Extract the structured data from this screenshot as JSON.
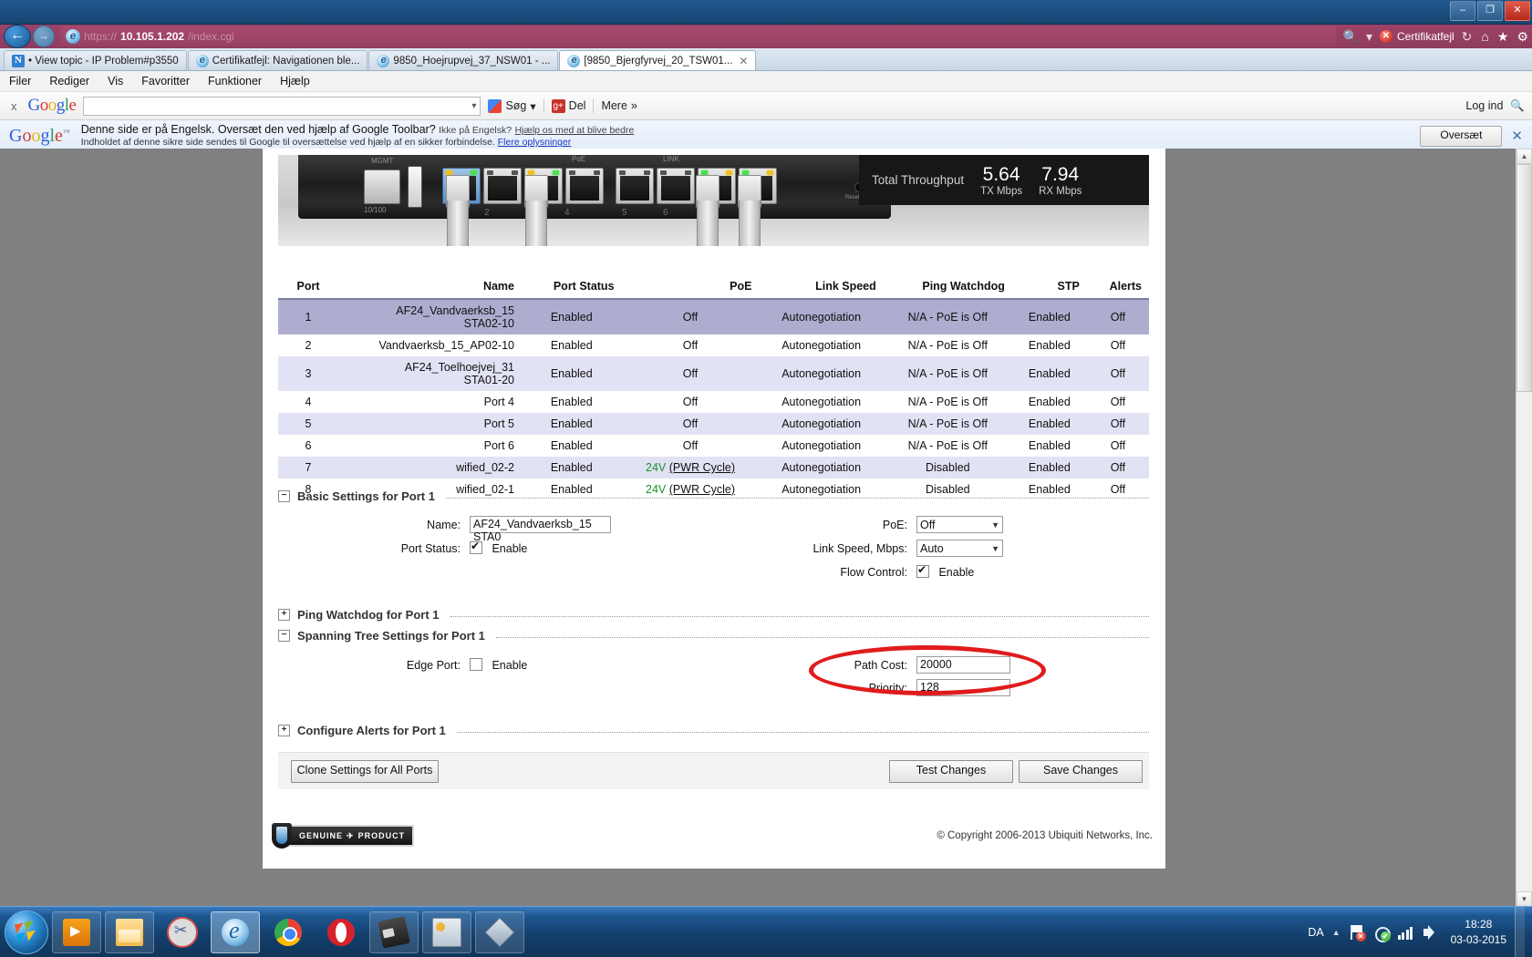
{
  "window": {
    "minimize_label": "–",
    "restore_label": "❐",
    "close_label": "✕"
  },
  "address_bar": {
    "protocol": "https://",
    "host": "10.105.1.202",
    "path": "/index.cgi",
    "back_icon": "←",
    "forward_icon": "→",
    "search_icon": "🔍",
    "dropdown_icon": "▾",
    "cert_error_label": "Certifikatfejl",
    "refresh_icon": "↻",
    "home_icon": "⌂",
    "favorites_icon": "★",
    "tools_icon": "⚙"
  },
  "tabs": [
    {
      "title": "• View topic - IP Problem#p3550",
      "icon": "N",
      "active": false,
      "closable": false
    },
    {
      "title": "Certifikatfejl: Navigationen ble...",
      "icon": "e",
      "active": false,
      "closable": false
    },
    {
      "title": "9850_Hoejrupvej_37_NSW01 - ...",
      "icon": "e",
      "active": false,
      "closable": false
    },
    {
      "title": "[9850_Bjergfyrvej_20_TSW01...",
      "icon": "e",
      "active": true,
      "closable": true,
      "close_label": "✕"
    }
  ],
  "menu_bar": [
    "Filer",
    "Rediger",
    "Vis",
    "Favoritter",
    "Funktioner",
    "Hjælp"
  ],
  "google_toolbar": {
    "close_label": "x",
    "logo": "Google",
    "search_input_value": "",
    "dropdown_icon": "▾",
    "search_label": "Søg",
    "search_caret": "▾",
    "share_label": "Del",
    "more_label": "Mere",
    "more_icon": "»",
    "login_label": "Log ind",
    "login_icon": "🔍"
  },
  "translate_bar": {
    "logo": "Google",
    "logo_tm": "™",
    "line1_main": "Denne side er på Engelsk. Oversæt den ved hjælp af Google Toolbar?",
    "line1_small": "Ikke på Engelsk?",
    "line1_link": "Hjælp os med at blive bedre",
    "line2_text": "Indholdet af denne sikre side sendes til Google til oversættelse ved hjælp af en sikker forbindelse.",
    "line2_link": "Flere oplysninger",
    "translate_button": "Oversæt",
    "close_label": "✕"
  },
  "device": {
    "mgmt_label": "MGMT",
    "poe_label": "PoE",
    "link_label": "LINK",
    "speed_label": "10/100",
    "reset_label": "Reset",
    "port_numbers": [
      "2",
      "4",
      "5",
      "6"
    ],
    "throughput_title": "Total Throughput",
    "tx_value": "5.64",
    "tx_unit": "TX Mbps",
    "rx_value": "7.94",
    "rx_unit": "RX Mbps"
  },
  "port_table": {
    "headers": [
      "Port",
      "Name",
      "Port Status",
      "PoE",
      "Link Speed",
      "Ping Watchdog",
      "STP",
      "Alerts"
    ],
    "rows": [
      {
        "port": "1",
        "name": "AF24_Vandvaerksb_15 STA02-10",
        "name_line1": "AF24_Vandvaerksb_15",
        "name_line2": "STA02-10",
        "status": "Enabled",
        "poe": "Off",
        "poe_voltage": "",
        "poe_link": "",
        "link_speed": "Autonegotiation",
        "watchdog": "N/A - PoE is Off",
        "stp": "Enabled",
        "alerts": "Off",
        "style": "selected"
      },
      {
        "port": "2",
        "name": "Vandvaerksb_15_AP02-10",
        "name_line1": "Vandvaerksb_15_AP02-10",
        "name_line2": "",
        "status": "Enabled",
        "poe": "Off",
        "poe_voltage": "",
        "poe_link": "",
        "link_speed": "Autonegotiation",
        "watchdog": "N/A - PoE is Off",
        "stp": "Enabled",
        "alerts": "Off",
        "style": "plain"
      },
      {
        "port": "3",
        "name": "AF24_Toelhoejvej_31 STA01-20",
        "name_line1": "AF24_Toelhoejvej_31",
        "name_line2": "STA01-20",
        "status": "Enabled",
        "poe": "Off",
        "poe_voltage": "",
        "poe_link": "",
        "link_speed": "Autonegotiation",
        "watchdog": "N/A - PoE is Off",
        "stp": "Enabled",
        "alerts": "Off",
        "style": "alt"
      },
      {
        "port": "4",
        "name": "Port 4",
        "name_line1": "Port 4",
        "name_line2": "",
        "status": "Enabled",
        "poe": "Off",
        "poe_voltage": "",
        "poe_link": "",
        "link_speed": "Autonegotiation",
        "watchdog": "N/A - PoE is Off",
        "stp": "Enabled",
        "alerts": "Off",
        "style": "plain"
      },
      {
        "port": "5",
        "name": "Port 5",
        "name_line1": "Port 5",
        "name_line2": "",
        "status": "Enabled",
        "poe": "Off",
        "poe_voltage": "",
        "poe_link": "",
        "link_speed": "Autonegotiation",
        "watchdog": "N/A - PoE is Off",
        "stp": "Enabled",
        "alerts": "Off",
        "style": "alt"
      },
      {
        "port": "6",
        "name": "Port 6",
        "name_line1": "Port 6",
        "name_line2": "",
        "status": "Enabled",
        "poe": "Off",
        "poe_voltage": "",
        "poe_link": "",
        "link_speed": "Autonegotiation",
        "watchdog": "N/A - PoE is Off",
        "stp": "Enabled",
        "alerts": "Off",
        "style": "plain"
      },
      {
        "port": "7",
        "name": "wified_02-2",
        "name_line1": "wified_02-2",
        "name_line2": "",
        "status": "Enabled",
        "poe": "",
        "poe_voltage": "24V",
        "poe_link": "(PWR Cycle)",
        "link_speed": "Autonegotiation",
        "watchdog": "Disabled",
        "stp": "Enabled",
        "alerts": "Off",
        "style": "alt"
      },
      {
        "port": "8",
        "name": "wified_02-1",
        "name_line1": "wified_02-1",
        "name_line2": "",
        "status": "Enabled",
        "poe": "",
        "poe_voltage": "24V",
        "poe_link": "(PWR Cycle)",
        "link_speed": "Autonegotiation",
        "watchdog": "Disabled",
        "stp": "Enabled",
        "alerts": "Off",
        "style": "plain"
      }
    ]
  },
  "basic_settings": {
    "section_title": "Basic Settings for Port 1",
    "toggle": "−",
    "name_label": "Name:",
    "name_value": "AF24_Vandvaerksb_15 STA0",
    "port_status_label": "Port Status:",
    "port_status_checked": true,
    "port_status_text": "Enable",
    "poe_label": "PoE:",
    "poe_value": "Off",
    "link_speed_label": "Link Speed, Mbps:",
    "link_speed_value": "Auto",
    "flow_control_label": "Flow Control:",
    "flow_control_checked": true,
    "flow_control_text": "Enable"
  },
  "ping_watchdog": {
    "section_title": "Ping Watchdog for Port 1",
    "toggle": "+"
  },
  "spanning_tree": {
    "section_title": "Spanning Tree Settings for Port 1",
    "toggle": "−",
    "edge_port_label": "Edge Port:",
    "edge_port_checked": false,
    "edge_port_text": "Enable",
    "path_cost_label": "Path Cost:",
    "path_cost_value": "20000",
    "priority_label": "Priority:",
    "priority_value": "128",
    "highlight_color": "#e01b1b"
  },
  "configure_alerts": {
    "section_title": "Configure Alerts for Port 1",
    "toggle": "+"
  },
  "buttons": {
    "clone": "Clone Settings for All Ports",
    "test": "Test Changes",
    "save": "Save Changes"
  },
  "footer": {
    "genuine_text_1": "GENUINE",
    "genuine_text_2": "PRODUCT",
    "copyright": "© Copyright 2006-2013 Ubiquiti Networks, Inc."
  },
  "scrollbar": {
    "up_arrow": "▲",
    "down_arrow": "▼"
  },
  "taskbar": {
    "items": [
      "windows-media-player",
      "file-explorer",
      "snipping-tool",
      "internet-explorer",
      "chrome",
      "opera",
      "usb-device",
      "monitoring-app",
      "archive-app"
    ],
    "tray": {
      "language": "DA",
      "expand_icon": "▲",
      "time": "18:28",
      "date": "03-03-2015"
    }
  }
}
